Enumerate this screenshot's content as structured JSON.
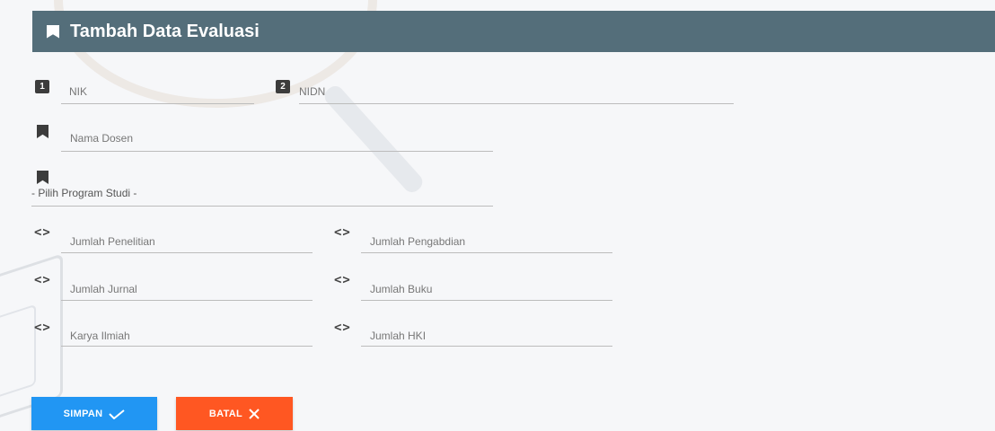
{
  "header": {
    "title": "Tambah Data Evaluasi",
    "icon": "bookmark-icon"
  },
  "form": {
    "nik": {
      "badge": "1",
      "placeholder": "NIK"
    },
    "nidn": {
      "badge": "2",
      "placeholder": "NIDN"
    },
    "nama_dosen": {
      "placeholder": "Nama Dosen"
    },
    "program_studi": {
      "selected": "- Pilih  Program Studi -"
    },
    "jumlah_penelitian": {
      "placeholder": "Jumlah Penelitian"
    },
    "jumlah_pengabdian": {
      "placeholder": "Jumlah Pengabdian"
    },
    "jumlah_jurnal": {
      "placeholder": "Jumlah Jurnal"
    },
    "jumlah_buku": {
      "placeholder": "Jumlah Buku"
    },
    "karya_ilmiah": {
      "placeholder": "Karya Ilmiah"
    },
    "jumlah_hki": {
      "placeholder": "Jumlah HKI"
    }
  },
  "buttons": {
    "simpan": {
      "label": "SIMPAN",
      "icon": "check-icon",
      "color": "#2196f3"
    },
    "batal": {
      "label": "BATAL",
      "icon": "close-icon",
      "color": "#ff5722"
    }
  },
  "colors": {
    "header": "#546e7a"
  }
}
